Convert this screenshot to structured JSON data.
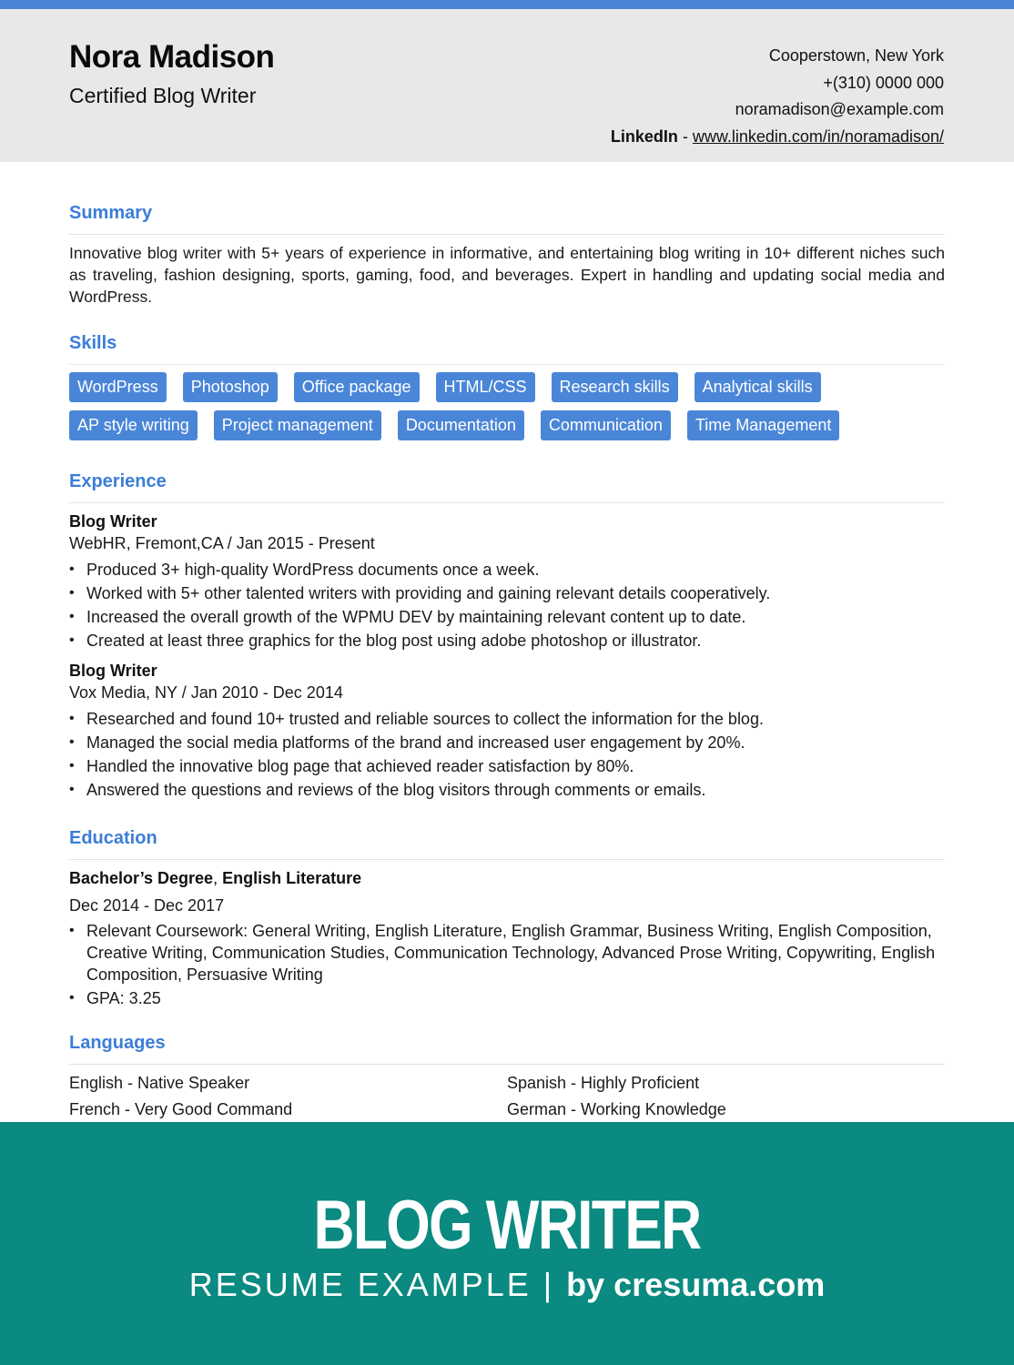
{
  "header": {
    "name": "Nora Madison",
    "title": "Certified Blog Writer",
    "contact": {
      "location": "Cooperstown, New York",
      "phone": "+(310) 0000 000",
      "email": "noramadison@example.com",
      "linkedin_label": "LinkedIn",
      "linkedin_separator": " - ",
      "linkedin_url": "www.linkedin.com/in/noramadison/"
    }
  },
  "colors": {
    "accent": "#4a86d8",
    "header_bg": "#e8e8e8",
    "banner_bg": "#0a8a80"
  },
  "summary": {
    "title": "Summary",
    "text": "Innovative blog writer with 5+ years of experience in informative, and entertaining blog writing in 10+ different niches such as traveling, fashion designing, sports, gaming, food, and beverages. Expert in handling and updating social media and WordPress."
  },
  "skills": {
    "title": "Skills",
    "rows": [
      [
        "WordPress",
        "Photoshop",
        "Office package",
        "HTML/CSS",
        "Research skills",
        "Analytical skills"
      ],
      [
        "AP style writing",
        "Project management",
        "Documentation",
        "Communication",
        "Time Management"
      ]
    ]
  },
  "experience": {
    "title": "Experience",
    "jobs": [
      {
        "role": "Blog Writer",
        "meta": "WebHR, Fremont,CA / Jan 2015 - Present",
        "bullets": [
          "Produced 3+ high-quality WordPress documents once a week.",
          "Worked with 5+ other talented writers with providing and gaining relevant details cooperatively.",
          "Increased the overall growth of the WPMU DEV by maintaining relevant content up to date.",
          "Created at least three graphics for the blog post using adobe photoshop or illustrator."
        ]
      },
      {
        "role": "Blog Writer",
        "meta": "Vox Media, NY / Jan 2010 - Dec 2014",
        "bullets": [
          "Researched and found 10+ trusted and reliable sources to collect the information for the blog.",
          "Managed the social media platforms of the brand and increased user engagement by 20%.",
          "Handled the innovative blog page that achieved reader satisfaction by 80%.",
          "Answered the questions and reviews of the blog visitors through comments or emails."
        ]
      }
    ]
  },
  "education": {
    "title": "Education",
    "degree": "Bachelor’s Degree",
    "separator": ", ",
    "field": "English Literature",
    "dates": "Dec 2014 - Dec 2017",
    "bullets": [
      "Relevant Coursework: General Writing, English Literature, English Grammar, Business Writing, English Composition, Creative Writing, Communication Studies, Communication Technology, Advanced Prose Writing, Copywriting, English Composition, Persuasive Writing",
      "GPA: 3.25"
    ]
  },
  "languages": {
    "title": "Languages",
    "items": [
      "English - Native Speaker",
      "Spanish - Highly Proficient",
      "French - Very Good Command",
      "German - Working Knowledge"
    ]
  },
  "banner": {
    "title": "BLOG WRITER",
    "subtitle_light": "RESUME EXAMPLE | ",
    "subtitle_bold": "by cresuma.com"
  }
}
